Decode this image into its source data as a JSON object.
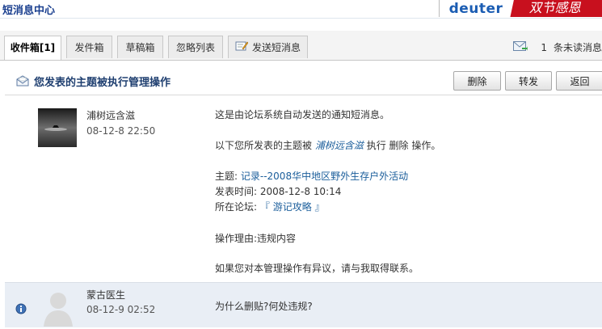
{
  "header": {
    "title": "短消息中心",
    "ad": {
      "brand": "deuter",
      "slogan": "双节感恩"
    }
  },
  "tabs": [
    {
      "label": "收件箱[1]",
      "active": true
    },
    {
      "label": "发件箱",
      "active": false
    },
    {
      "label": "草稿箱",
      "active": false
    },
    {
      "label": "忽略列表",
      "active": false
    },
    {
      "label": "发送短消息",
      "active": false,
      "icon": "compose-icon"
    }
  ],
  "unread": {
    "count": "1",
    "label": "条未读消息"
  },
  "message": {
    "subject": "您发表的主题被执行管理操作",
    "buttons": {
      "delete": "删除",
      "forward": "转发",
      "back": "返回"
    }
  },
  "posts": [
    {
      "author": "浦树远含滋",
      "time": "08-12-8 22:50",
      "lines": {
        "intro": "这是由论坛系统自动发送的通知短消息。",
        "action_prefix": "以下您所发表的主题被",
        "action_user": "浦树远含滋",
        "action_mid": "执行",
        "action_op": "删除",
        "action_suffix": "操作。",
        "topic_label": "主题:",
        "topic_link": "记录--2008华中地区野外生存户外活动",
        "posttime_label": "发表时间:",
        "posttime_value": "2008-12-8 10:14",
        "forum_label": "所在论坛:",
        "forum_link": "『 游记攻略 』",
        "reason_label": "操作理由:",
        "reason_value": "违规内容",
        "footer": "如果您对本管理操作有异议，请与我取得联系。"
      }
    },
    {
      "author": "蒙古医生",
      "time": "08-12-9 02:52",
      "text": "为什么删贴?何处违规?"
    }
  ]
}
